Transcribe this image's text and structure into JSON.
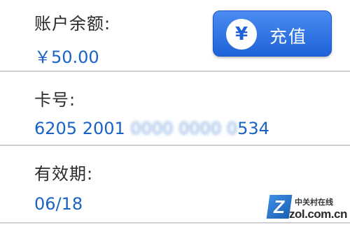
{
  "balance": {
    "label": "账户余额:",
    "value": "￥50.00"
  },
  "recharge_button": {
    "icon": "yen-icon",
    "icon_glyph": "¥",
    "label": "充值"
  },
  "card": {
    "label": "卡号:",
    "value_visible_prefix": "6205 2001 ",
    "value_blurred": "0000 0000 0",
    "value_visible_suffix": "534"
  },
  "expiry": {
    "label": "有效期:",
    "value": "06/18"
  },
  "watermark": {
    "logo_letter": "Z",
    "text_cn": "中关村在线",
    "text_en": "zol.com.cn"
  },
  "colors": {
    "value_text": "#1a63c6",
    "button": "#2a6fe0"
  }
}
